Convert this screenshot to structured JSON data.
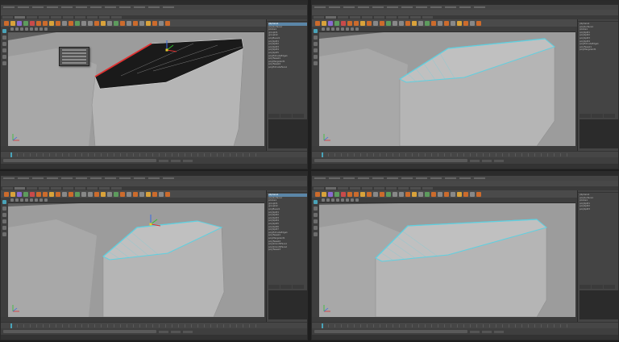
{
  "colors": {
    "accent": "#4aa3b8",
    "selected_edge": "#e03030",
    "wire": "#5fd0e0"
  },
  "shelf_icons": [
    "#cc6b2c",
    "#d9a23a",
    "#8a6ad0",
    "#5d9b5d",
    "#c94a4a",
    "#cc6b2c",
    "#cc6b2c",
    "#d9a23a",
    "#cc6b2c",
    "#888",
    "#cc6b2c",
    "#5d9b5d",
    "#888",
    "#888",
    "#cc6b2c",
    "#d9a23a",
    "#888",
    "#5d9b5d",
    "#cc6b2c",
    "#888",
    "#cc6b2c",
    "#888",
    "#d9a23a",
    "#cc6b2c",
    "#888",
    "#cc6b2c"
  ],
  "panels": [
    {
      "outliner": [
        "pSphere1",
        "polySurface1",
        "pCube1",
        "groupId1",
        "groupId2",
        "polyBevel1",
        "polySplit1",
        "polySplit2",
        "polySplit3",
        "polySplit4",
        "polySplit5",
        "polyExtrudeEdge1",
        "polyTweak1",
        "polyMergeVert1",
        "polyTweak2",
        "polyExtrudeFace1"
      ],
      "highlight": 0,
      "has_menu": true
    },
    {
      "outliner": [
        "pSphere1",
        "polySurface1",
        "pCube1",
        "polySplit1",
        "polySplit2",
        "polySplit3",
        "polySplit4",
        "polyExtrudeEdge1",
        "polyTweak1",
        "polyMergeVert1"
      ],
      "highlight": -1,
      "has_menu": false
    },
    {
      "outliner": [
        "pSphere1",
        "polySurface1",
        "pCube1",
        "groupId1",
        "groupId2",
        "polyBevel1",
        "polySplit1",
        "polySplit2",
        "polySplit3",
        "polySplit4",
        "polySplit5",
        "polySplit6",
        "polySplit7",
        "polyExtrudeEdge1",
        "polyTweak1",
        "polyMergeVert1",
        "polyTweak2",
        "polySmoothFace1",
        "polySmoothFace2",
        "polyTweak3"
      ],
      "highlight": 0,
      "has_menu": false
    },
    {
      "outliner": [
        "pSphere1",
        "polySurface1",
        "pCube1",
        "polySplit1",
        "polySplit2",
        "polySplit3"
      ],
      "highlight": -1,
      "has_menu": false
    }
  ]
}
